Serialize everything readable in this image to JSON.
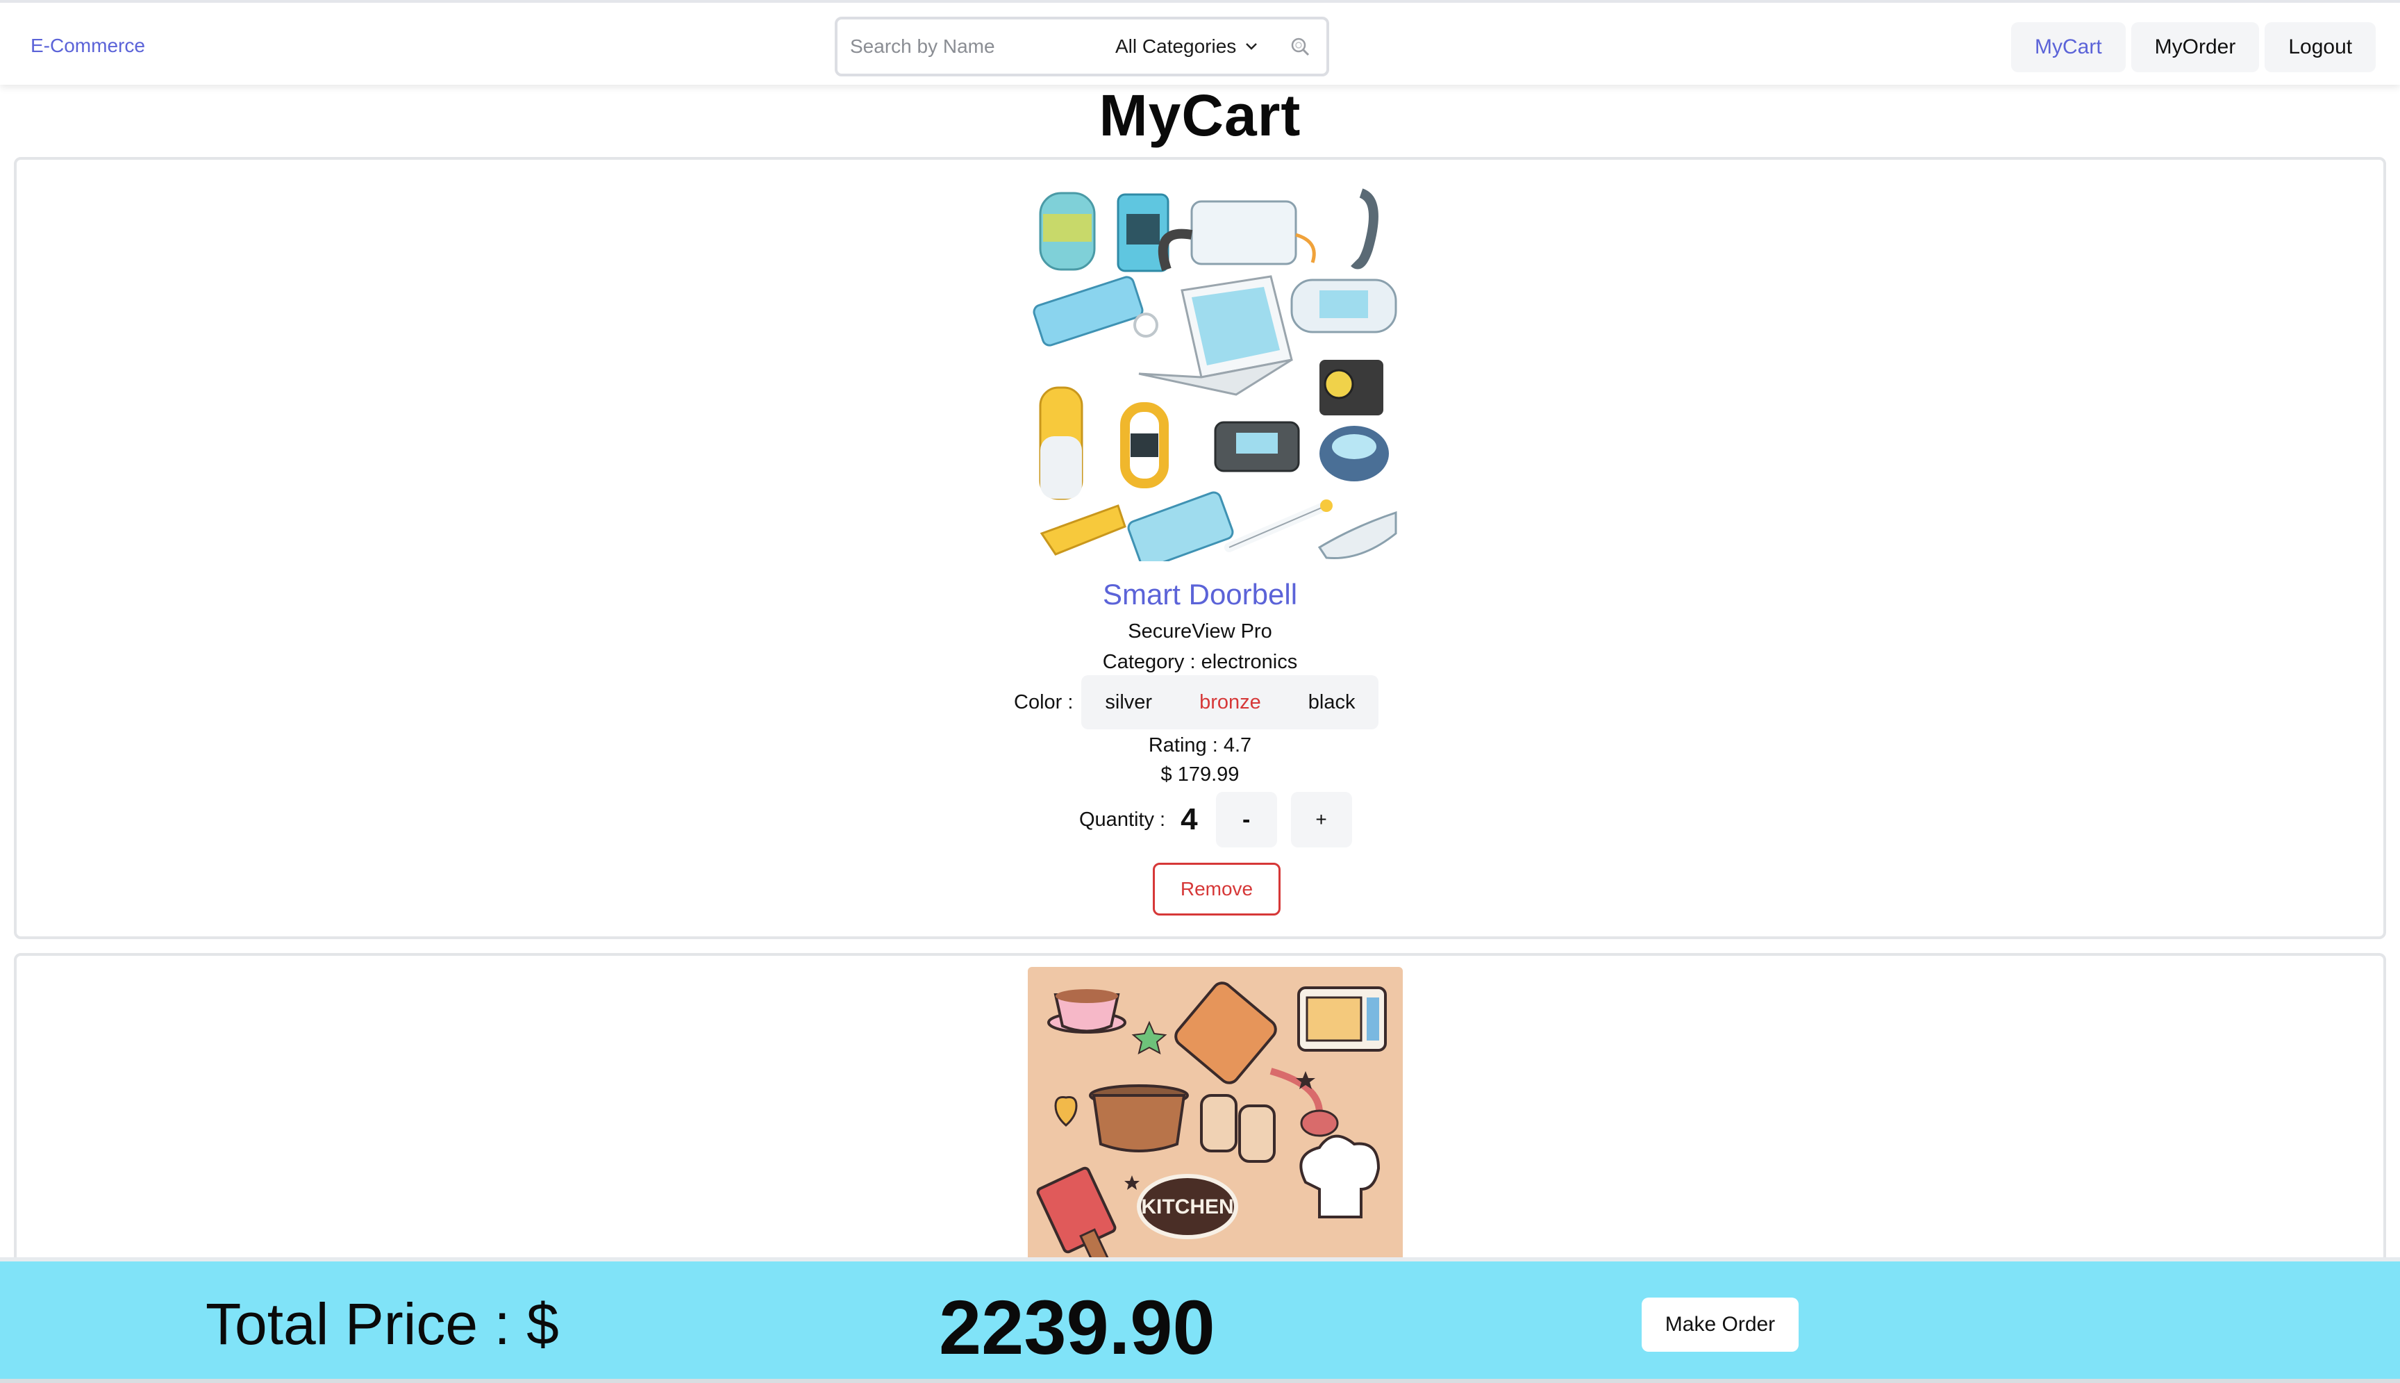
{
  "nav": {
    "brand": "E-Commerce",
    "search_placeholder": "Search by Name",
    "category_select": "All Categories",
    "links": [
      {
        "label": "MyCart",
        "active": true
      },
      {
        "label": "MyOrder",
        "active": false
      },
      {
        "label": "Logout",
        "active": false
      }
    ]
  },
  "page": {
    "title": "MyCart"
  },
  "cart_items": [
    {
      "name": "Smart Doorbell",
      "brand": "SecureView Pro",
      "category": "Category : electronics",
      "color_label": "Color :",
      "colors": [
        "silver",
        "bronze",
        "black"
      ],
      "selected_color": "bronze",
      "rating": "Rating : 4.7",
      "price": "$ 179.99",
      "quantity_label": "Quantity :",
      "quantity": "4",
      "decrement_label": "-",
      "increment_label": "+",
      "remove_label": "Remove",
      "image_icon": "electronics-illustration"
    },
    {
      "image_icon": "kitchen-illustration"
    }
  ],
  "footer": {
    "total_label": "Total Price : $",
    "total_value": "2239.90",
    "make_order_label": "Make Order"
  },
  "colors": {
    "accent": "#5b63d8",
    "danger": "#d63838",
    "total_bar_bg": "#80e3f8",
    "kitchen_bg": "#efc7a6"
  }
}
